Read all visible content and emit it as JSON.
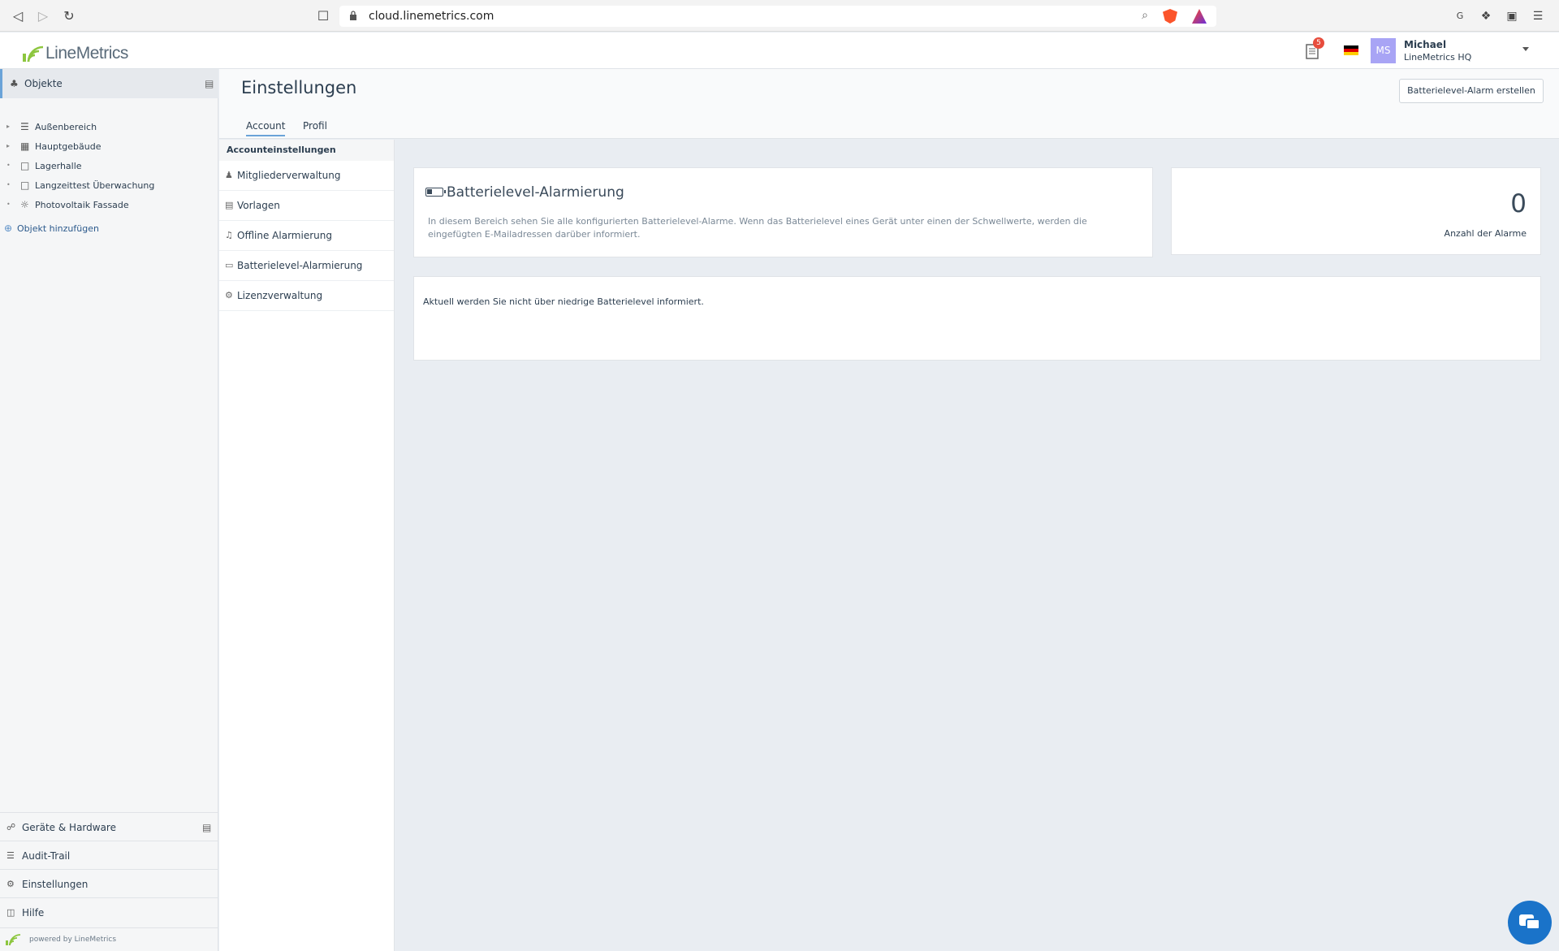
{
  "browser": {
    "url": "cloud.linemetrics.com",
    "back_icon": "back-icon",
    "forward_icon": "forward-icon",
    "reload_icon": "reload-icon",
    "ext_google": "G"
  },
  "header": {
    "logo_text": "LineMetrics",
    "notification_count": "5",
    "avatar_initials": "MS",
    "user_name": "Michael",
    "user_org": "LineMetrics HQ"
  },
  "sidebar": {
    "section_title": "Objekte",
    "tree": [
      {
        "label": "Außenbereich",
        "icon": "list-icon",
        "expandable": true
      },
      {
        "label": "Hauptgebäude",
        "icon": "building-icon",
        "expandable": true
      },
      {
        "label": "Lagerhalle",
        "icon": "area-icon",
        "expandable": false
      },
      {
        "label": "Langzeittest Überwachung",
        "icon": "area-icon",
        "expandable": false
      },
      {
        "label": "Photovoltaik Fassade",
        "icon": "sun-icon",
        "expandable": false
      }
    ],
    "add_object": "Objekt hinzufügen",
    "bottom": [
      {
        "label": "Geräte & Hardware"
      },
      {
        "label": "Audit-Trail"
      },
      {
        "label": "Einstellungen"
      },
      {
        "label": "Hilfe"
      }
    ],
    "powered_by": "powered by LineMetrics"
  },
  "main": {
    "title": "Einstellungen",
    "tabs": [
      {
        "label": "Account",
        "active": true
      },
      {
        "label": "Profil",
        "active": false
      }
    ],
    "create_button": "Batterielevel-Alarm erstellen"
  },
  "settings_menu": {
    "heading": "Accounteinstellungen",
    "items": [
      {
        "label": "Mitgliederverwaltung"
      },
      {
        "label": "Vorlagen"
      },
      {
        "label": "Offline Alarmierung"
      },
      {
        "label": "Batterielevel-Alarmierung"
      },
      {
        "label": "Lizenzverwaltung"
      }
    ]
  },
  "content": {
    "card_title": "Batterielevel-Alarmierung",
    "card_desc": "In diesem Bereich sehen Sie alle konfigurierten Batterielevel-Alarme. Wenn das Batterielevel eines Gerät unter einen der Schwellwerte, werden die eingefügten E-Mailadressen darüber informiert.",
    "alarm_count": "0",
    "alarm_count_label": "Anzahl der Alarme",
    "info": "Aktuell werden Sie nicht über niedrige Batterielevel informiert."
  },
  "colors": {
    "accent": "#6aa3d8",
    "chat": "#1a73c9",
    "badge": "#e74c3c"
  }
}
